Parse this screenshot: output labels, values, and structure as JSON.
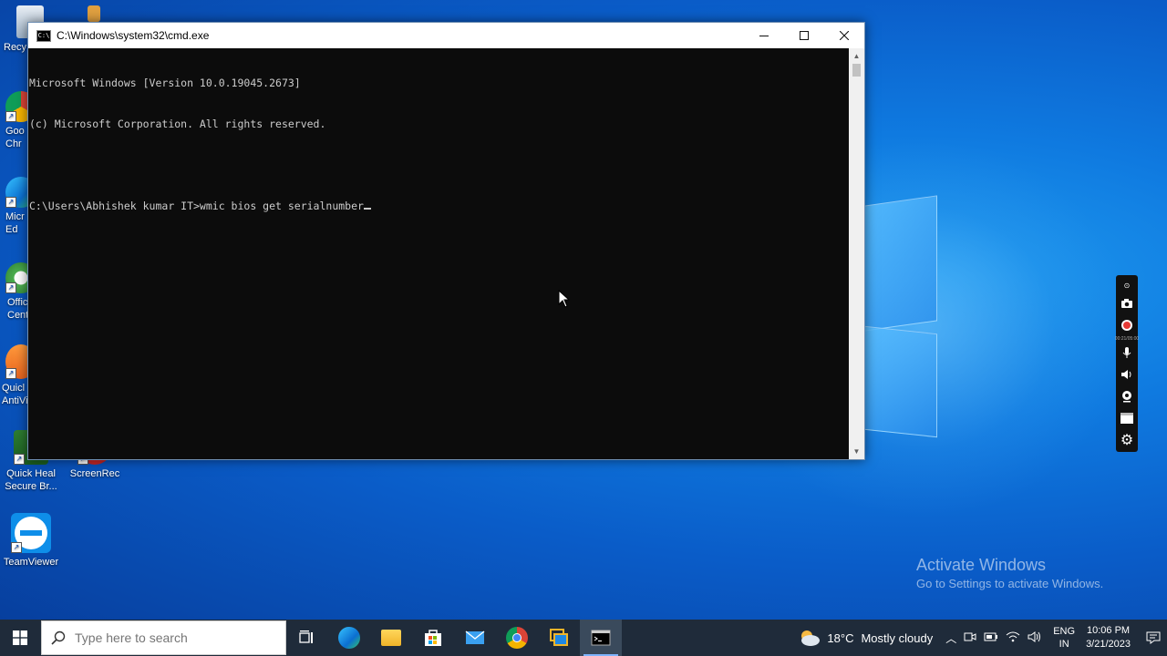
{
  "desktop": {
    "icons": [
      {
        "label": "Recy",
        "name": "recycle-bin"
      },
      {
        "label": "Goo Chr",
        "name": "google-chrome"
      },
      {
        "label": "Micr Ed",
        "name": "microsoft-edge"
      },
      {
        "label": "Offic Cent",
        "name": "office-center"
      },
      {
        "label": "Quicl AntiVi",
        "name": "quick-heal-antivirus"
      },
      {
        "label": "Quick Heal Secure Br...",
        "name": "quick-heal-secure-browser"
      },
      {
        "label": "ScreenRec",
        "name": "screenrec"
      },
      {
        "label": "TeamViewer",
        "name": "teamviewer"
      }
    ],
    "watermark": {
      "line1": "Activate Windows",
      "line2": "Go to Settings to activate Windows."
    }
  },
  "window": {
    "title": "C:\\Windows\\system32\\cmd.exe",
    "controls": {
      "minimize": "—",
      "maximize": "☐",
      "close": "✕"
    },
    "console_lines": [
      "Microsoft Windows [Version 10.0.19045.2673]",
      "(c) Microsoft Corporation. All rights reserved.",
      "",
      "C:\\Users\\Abhishek kumar IT>wmic bios get serialnumber"
    ]
  },
  "recorder": {
    "timer": "00:21/05:00"
  },
  "taskbar": {
    "search_placeholder": "Type here to search",
    "apps": [
      "task-view",
      "microsoft-edge",
      "file-explorer",
      "microsoft-store",
      "mail",
      "google-chrome",
      "remote-app",
      "command-prompt"
    ],
    "weather": {
      "temp": "18°C",
      "condition": "Mostly cloudy"
    },
    "language": {
      "line1": "ENG",
      "line2": "IN"
    },
    "clock": {
      "time": "10:06 PM",
      "date": "3/21/2023"
    }
  },
  "colors": {
    "console_bg": "#0c0c0c",
    "console_text": "#cccccc",
    "taskbar": "#1f2b3a",
    "desktop": "#0a5fc4"
  }
}
